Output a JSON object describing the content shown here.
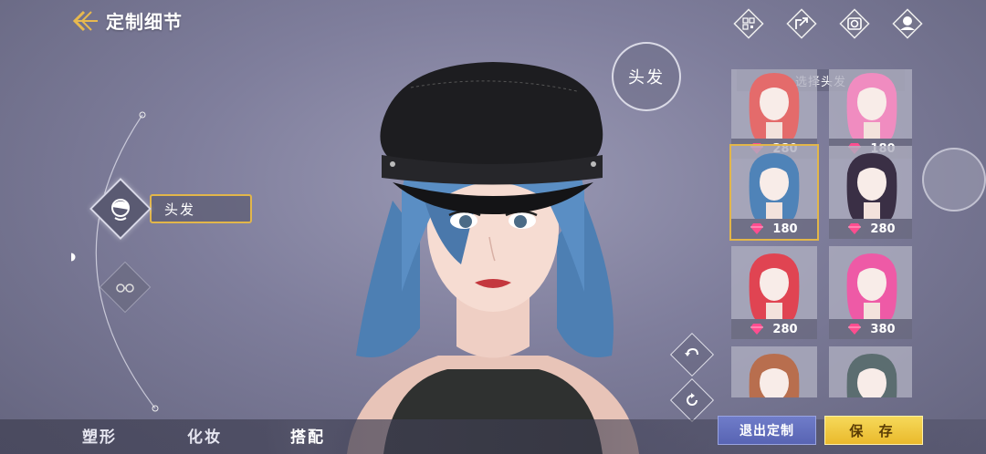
{
  "header": {
    "title": "定制细节"
  },
  "left_menu": {
    "hair_label": "头发"
  },
  "center": {
    "hair_circle_label": "头发"
  },
  "top_icons": [
    "qr-code-icon",
    "share-icon",
    "camera-icon",
    "avatar-icon"
  ],
  "panel": {
    "title": "选择头发",
    "items": [
      {
        "price": "280",
        "hair_color": "#e46b6b",
        "selected": false
      },
      {
        "price": "180",
        "hair_color": "#f08cc0",
        "selected": false
      },
      {
        "price": "180",
        "hair_color": "#4f83b8",
        "selected": true
      },
      {
        "price": "280",
        "hair_color": "#3a2f45",
        "selected": false
      },
      {
        "price": "280",
        "hair_color": "#e04452",
        "selected": false
      },
      {
        "price": "380",
        "hair_color": "#ee5aa6",
        "selected": false
      },
      {
        "price": "",
        "hair_color": "#b86e4e",
        "selected": false
      },
      {
        "price": "",
        "hair_color": "#5b6d70",
        "selected": false
      }
    ]
  },
  "bottom_tabs": [
    {
      "label": "塑形"
    },
    {
      "label": "化妆"
    },
    {
      "label": "搭配",
      "active": true
    }
  ],
  "buttons": {
    "exit": "退出定制",
    "save": "保 存"
  },
  "colors": {
    "accent_gold": "#e2b64a",
    "exit_blue": "#5f6bbd",
    "save_yellow": "#f2c83c"
  }
}
